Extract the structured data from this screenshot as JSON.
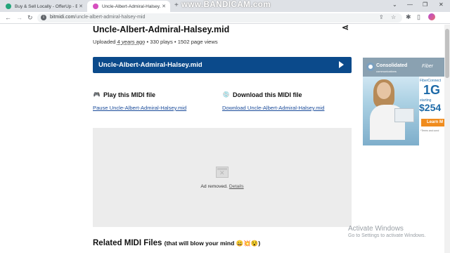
{
  "browser": {
    "tabs": [
      {
        "title": "Buy & Sell Locally - OfferUp - B...",
        "active": false,
        "favicon_color": "#23a57a"
      },
      {
        "title": "Uncle-Albert-Admiral-Halsey.mid",
        "active": true,
        "favicon_color": "#d64fbf"
      }
    ],
    "new_tab": "+",
    "recorder_watermark": "www.BANDICAM.com",
    "window_controls": [
      "⌄",
      "—",
      "❐",
      "✕"
    ],
    "url_domain": "bitmidi.com",
    "url_path": "/uncle-albert-admiral-halsey-mid",
    "nav": {
      "back": "←",
      "forward": "→",
      "reload": "↻"
    },
    "omni_icons": [
      "⇪",
      "☆"
    ],
    "toolbar_icons": [
      "✱",
      "▯"
    ]
  },
  "page": {
    "title": "Uncle-Albert-Admiral-Halsey.mid",
    "share_icon": "⋖",
    "meta": {
      "uploaded_label": "Uploaded",
      "uploaded_when": "4 years ago",
      "plays": "330 plays",
      "views": "1502 page views",
      "separator": "•"
    },
    "player": {
      "label": "Uncle-Albert-Admiral-Halsey.mid"
    },
    "play_section": {
      "heading": "Play this MIDI file",
      "link": "Pause Uncle-Albert-Admiral-Halsey.mid",
      "icon": "🎮"
    },
    "download_section": {
      "heading": "Download this MIDI file",
      "link": "Download Uncle-Albert-Admiral-Halsey.mid",
      "icon": "💿"
    },
    "ad_notice": {
      "text": "Ad removed.",
      "link": "Details"
    },
    "related": {
      "heading": "Related MIDI Files",
      "subheading": "(that will blow your mind 😄💥😵)"
    }
  },
  "side_ad": {
    "brand": "Consolidated",
    "brand_sub": "communications",
    "fiber_label": "Fiber",
    "panel_heading": "FiberConnect",
    "speed": "1G",
    "start_text": "starting",
    "price": "$254",
    "button": "Learn M",
    "fine_print": "*Terms and cond"
  },
  "os_watermark": {
    "line1": "Activate Windows",
    "line2": "Go to Settings to activate Windows."
  }
}
